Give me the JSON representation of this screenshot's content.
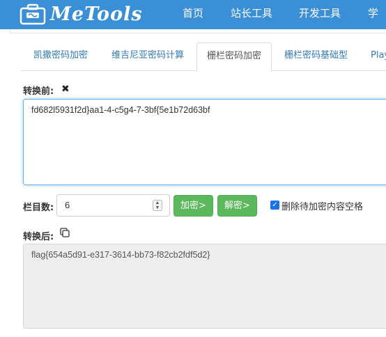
{
  "header": {
    "logo_text": "MeTools",
    "nav": [
      "首页",
      "站长工具",
      "开发工具",
      "学习"
    ],
    "colors": {
      "bar": "#3a8fd6"
    }
  },
  "tabs": [
    {
      "label": "凯撒密码加密",
      "active": false
    },
    {
      "label": "维吉尼亚密码计算",
      "active": false
    },
    {
      "label": "栅栏密码加密",
      "active": true
    },
    {
      "label": "栅栏密码基础型",
      "active": false
    },
    {
      "label": "Play",
      "active": false
    }
  ],
  "before": {
    "label": "转换前:",
    "clear_icon": "close-icon",
    "text": "fd682l5931f2d}aa1-4-c5g4-7-3bf{5e1b72d63bf"
  },
  "controls": {
    "rails_label": "栏目数:",
    "rails_value": "6",
    "encrypt_label": "加密>",
    "decrypt_label": "解密>",
    "checkbox_label": "删除待加密内容空格",
    "checkbox_checked": true,
    "button_color": "#5cb85c"
  },
  "after": {
    "label": "转换后:",
    "copy_icon": "copy-icon",
    "text": "flag{654a5d91-e317-3614-bb73-f82cb2fdf5d2}"
  }
}
